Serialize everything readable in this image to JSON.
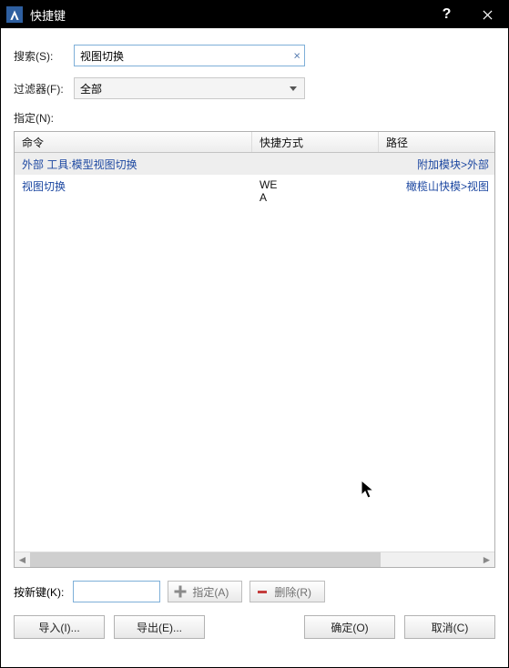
{
  "window": {
    "title": "快捷键",
    "help_tip": "?",
    "close_tip": "×"
  },
  "search": {
    "label": "搜索(S):",
    "value": "视图切换",
    "placeholder": ""
  },
  "filter": {
    "label": "过滤器(F):",
    "selected": "全部"
  },
  "assign": {
    "label": "指定(N):"
  },
  "table": {
    "headers": {
      "command": "命令",
      "shortcut": "快捷方式",
      "path": "路径"
    },
    "rows": [
      {
        "command": "外部 工具:模型视图切换",
        "shortcut": "",
        "path": "附加模块>外部",
        "selected": true
      },
      {
        "command": "视图切换",
        "shortcut": "WE\nA",
        "path": "橄榄山快模>视图",
        "selected": false
      }
    ]
  },
  "newkey": {
    "label": "按新键(K):",
    "value": "",
    "assign_btn": "指定(A)",
    "remove_btn": "删除(R)"
  },
  "buttons": {
    "import": "导入(I)...",
    "export": "导出(E)...",
    "ok": "确定(O)",
    "cancel": "取消(C)"
  }
}
